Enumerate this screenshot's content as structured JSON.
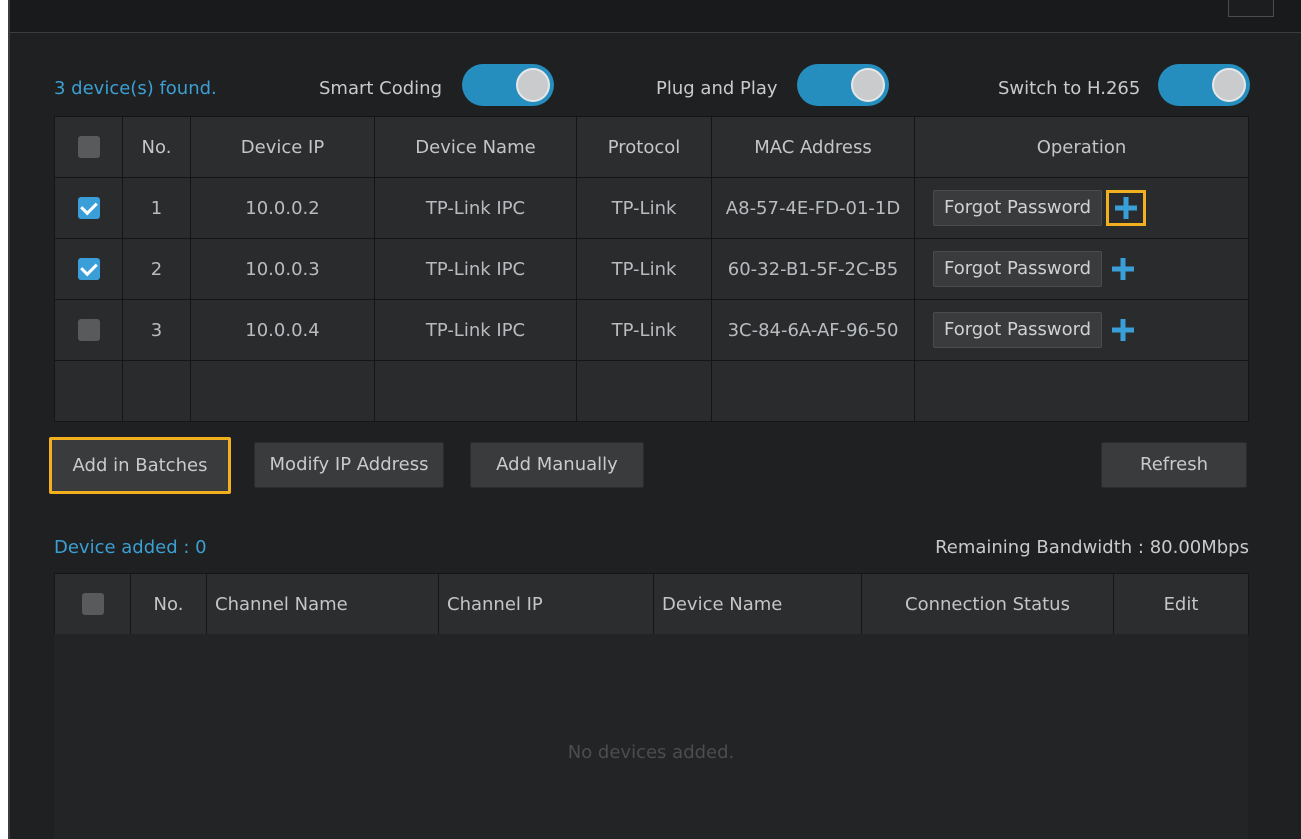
{
  "status": {
    "devices_found": "3 device(s) found.",
    "toggles": [
      {
        "label": "Smart Coding",
        "on": true
      },
      {
        "label": "Plug and Play",
        "on": true
      },
      {
        "label": "Switch to H.265",
        "on": true
      }
    ]
  },
  "device_table": {
    "headers": [
      "No.",
      "Device IP",
      "Device Name",
      "Protocol",
      "MAC Address",
      "Operation"
    ],
    "rows": [
      {
        "no": "1",
        "ip": "10.0.0.2",
        "name": "TP-Link IPC",
        "protocol": "TP-Link",
        "mac": "A8-57-4E-FD-01-1D",
        "op_label": "Forgot Password",
        "checked": true
      },
      {
        "no": "2",
        "ip": "10.0.0.3",
        "name": "TP-Link IPC",
        "protocol": "TP-Link",
        "mac": "60-32-B1-5F-2C-B5",
        "op_label": "Forgot Password",
        "checked": true
      },
      {
        "no": "3",
        "ip": "10.0.0.4",
        "name": "TP-Link IPC",
        "protocol": "TP-Link",
        "mac": "3C-84-6A-AF-96-50",
        "op_label": "Forgot Password",
        "checked": false
      }
    ]
  },
  "actions": {
    "add_in_batches": "Add in Batches",
    "modify_ip": "Modify IP Address",
    "add_manually": "Add Manually",
    "refresh": "Refresh"
  },
  "added": {
    "count_label": "Device added : 0",
    "bandwidth_label": "Remaining Bandwidth : 80.00Mbps"
  },
  "channel_table": {
    "headers": [
      "No.",
      "Channel Name",
      "Channel IP",
      "Device Name",
      "Connection Status",
      "Edit"
    ],
    "empty_text": "No devices added."
  },
  "colors": {
    "accent": "#3a9fd8",
    "highlight": "#f2b01e",
    "background": "#1f2021"
  }
}
